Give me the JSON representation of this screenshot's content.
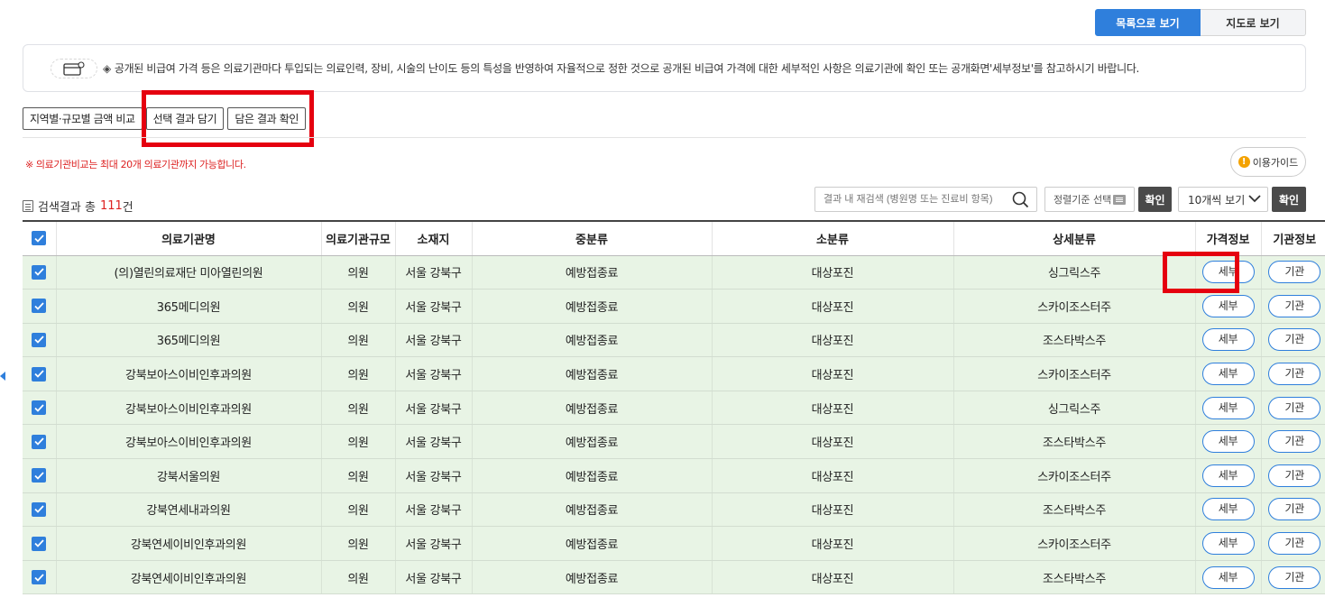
{
  "view_toggle": {
    "list_label": "목록으로 보기",
    "map_label": "지도로 보기"
  },
  "notice": {
    "text": "공개된 비급여 가격 등은 의료기관마다 투입되는 의료인력, 장비, 시술의 난이도 등의 특성을 반영하여 자율적으로 정한 것으로 공개된 비급여 가격에 대한 세부적인 사항은 의료기관에 확인 또는 공개화면'세부정보'를 참고하시기 바랍니다."
  },
  "actions": {
    "compare_label": "지역별·규모별 금액 비교",
    "save_label": "선택 결과 담기",
    "check_label": "담은 결과 확인"
  },
  "limit_note": "※ 의료기관비교는 최대 20개 의료기관까지 가능합니다.",
  "guide_label": "이용가이드",
  "results": {
    "prefix": "검색결과 총 ",
    "count": "111",
    "suffix": "건"
  },
  "search": {
    "placeholder": "결과 내 재검색 (병원명 또는 진료비 항목)",
    "confirm_label": "확인"
  },
  "sort": {
    "label": "정렬기준 선택"
  },
  "per_page": {
    "label": "10개씩 보기",
    "confirm_label": "확인"
  },
  "table": {
    "headers": [
      "의료기관명",
      "의료기관규모",
      "소재지",
      "중분류",
      "소분류",
      "상세분류",
      "가격정보",
      "기관정보"
    ],
    "detail_label": "세부",
    "org_label": "기관",
    "rows": [
      {
        "name": "(의)열린의료재단 미아열린의원",
        "size": "의원",
        "loc": "서울 강북구",
        "mid": "예방접종료",
        "sub": "대상포진",
        "detail": "싱그릭스주",
        "checked": true
      },
      {
        "name": "365메디의원",
        "size": "의원",
        "loc": "서울 강북구",
        "mid": "예방접종료",
        "sub": "대상포진",
        "detail": "스카이조스터주",
        "checked": true
      },
      {
        "name": "365메디의원",
        "size": "의원",
        "loc": "서울 강북구",
        "mid": "예방접종료",
        "sub": "대상포진",
        "detail": "조스타박스주",
        "checked": true
      },
      {
        "name": "강북보아스이비인후과의원",
        "size": "의원",
        "loc": "서울 강북구",
        "mid": "예방접종료",
        "sub": "대상포진",
        "detail": "스카이조스터주",
        "checked": true
      },
      {
        "name": "강북보아스이비인후과의원",
        "size": "의원",
        "loc": "서울 강북구",
        "mid": "예방접종료",
        "sub": "대상포진",
        "detail": "싱그릭스주",
        "checked": true
      },
      {
        "name": "강북보아스이비인후과의원",
        "size": "의원",
        "loc": "서울 강북구",
        "mid": "예방접종료",
        "sub": "대상포진",
        "detail": "조스타박스주",
        "checked": true
      },
      {
        "name": "강북서울의원",
        "size": "의원",
        "loc": "서울 강북구",
        "mid": "예방접종료",
        "sub": "대상포진",
        "detail": "스카이조스터주",
        "checked": true
      },
      {
        "name": "강북연세내과의원",
        "size": "의원",
        "loc": "서울 강북구",
        "mid": "예방접종료",
        "sub": "대상포진",
        "detail": "조스타박스주",
        "checked": true
      },
      {
        "name": "강북연세이비인후과의원",
        "size": "의원",
        "loc": "서울 강북구",
        "mid": "예방접종료",
        "sub": "대상포진",
        "detail": "스카이조스터주",
        "checked": true
      },
      {
        "name": "강북연세이비인후과의원",
        "size": "의원",
        "loc": "서울 강북구",
        "mid": "예방접종료",
        "sub": "대상포진",
        "detail": "조스타박스주",
        "checked": true
      }
    ]
  },
  "colors": {
    "accent": "#2f7fdc",
    "highlight": "#e5000f",
    "row_bg": "#e8f4e5",
    "warning": "#d22222"
  },
  "icons": {
    "notice": "card-icon",
    "search": "search-icon",
    "guide": "info-icon",
    "sort": "list-icon",
    "dropdown": "chevron-down-icon",
    "checkbox": "check-icon"
  }
}
